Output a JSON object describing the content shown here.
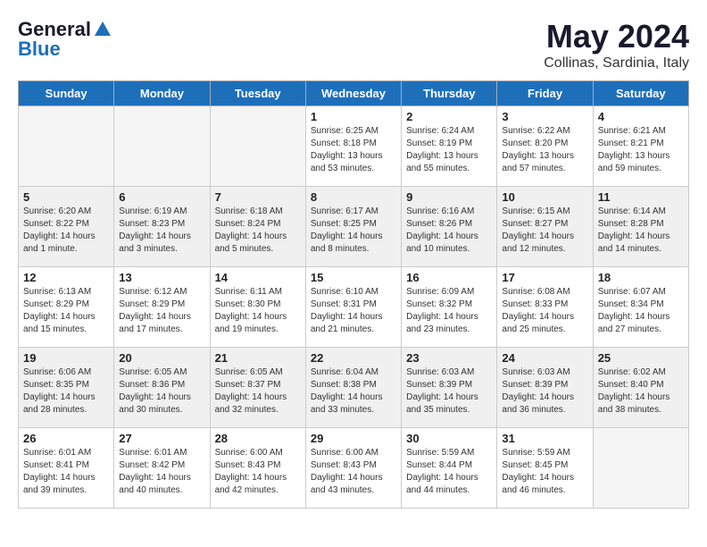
{
  "header": {
    "logo_general": "General",
    "logo_blue": "Blue",
    "month_title": "May 2024",
    "location": "Collinas, Sardinia, Italy"
  },
  "weekdays": [
    "Sunday",
    "Monday",
    "Tuesday",
    "Wednesday",
    "Thursday",
    "Friday",
    "Saturday"
  ],
  "weeks": [
    {
      "days": [
        {
          "number": null,
          "sunrise": "",
          "sunset": "",
          "daylight": ""
        },
        {
          "number": null,
          "sunrise": "",
          "sunset": "",
          "daylight": ""
        },
        {
          "number": null,
          "sunrise": "",
          "sunset": "",
          "daylight": ""
        },
        {
          "number": "1",
          "sunrise": "Sunrise: 6:25 AM",
          "sunset": "Sunset: 8:18 PM",
          "daylight": "Daylight: 13 hours and 53 minutes."
        },
        {
          "number": "2",
          "sunrise": "Sunrise: 6:24 AM",
          "sunset": "Sunset: 8:19 PM",
          "daylight": "Daylight: 13 hours and 55 minutes."
        },
        {
          "number": "3",
          "sunrise": "Sunrise: 6:22 AM",
          "sunset": "Sunset: 8:20 PM",
          "daylight": "Daylight: 13 hours and 57 minutes."
        },
        {
          "number": "4",
          "sunrise": "Sunrise: 6:21 AM",
          "sunset": "Sunset: 8:21 PM",
          "daylight": "Daylight: 13 hours and 59 minutes."
        }
      ]
    },
    {
      "days": [
        {
          "number": "5",
          "sunrise": "Sunrise: 6:20 AM",
          "sunset": "Sunset: 8:22 PM",
          "daylight": "Daylight: 14 hours and 1 minute."
        },
        {
          "number": "6",
          "sunrise": "Sunrise: 6:19 AM",
          "sunset": "Sunset: 8:23 PM",
          "daylight": "Daylight: 14 hours and 3 minutes."
        },
        {
          "number": "7",
          "sunrise": "Sunrise: 6:18 AM",
          "sunset": "Sunset: 8:24 PM",
          "daylight": "Daylight: 14 hours and 5 minutes."
        },
        {
          "number": "8",
          "sunrise": "Sunrise: 6:17 AM",
          "sunset": "Sunset: 8:25 PM",
          "daylight": "Daylight: 14 hours and 8 minutes."
        },
        {
          "number": "9",
          "sunrise": "Sunrise: 6:16 AM",
          "sunset": "Sunset: 8:26 PM",
          "daylight": "Daylight: 14 hours and 10 minutes."
        },
        {
          "number": "10",
          "sunrise": "Sunrise: 6:15 AM",
          "sunset": "Sunset: 8:27 PM",
          "daylight": "Daylight: 14 hours and 12 minutes."
        },
        {
          "number": "11",
          "sunrise": "Sunrise: 6:14 AM",
          "sunset": "Sunset: 8:28 PM",
          "daylight": "Daylight: 14 hours and 14 minutes."
        }
      ]
    },
    {
      "days": [
        {
          "number": "12",
          "sunrise": "Sunrise: 6:13 AM",
          "sunset": "Sunset: 8:29 PM",
          "daylight": "Daylight: 14 hours and 15 minutes."
        },
        {
          "number": "13",
          "sunrise": "Sunrise: 6:12 AM",
          "sunset": "Sunset: 8:29 PM",
          "daylight": "Daylight: 14 hours and 17 minutes."
        },
        {
          "number": "14",
          "sunrise": "Sunrise: 6:11 AM",
          "sunset": "Sunset: 8:30 PM",
          "daylight": "Daylight: 14 hours and 19 minutes."
        },
        {
          "number": "15",
          "sunrise": "Sunrise: 6:10 AM",
          "sunset": "Sunset: 8:31 PM",
          "daylight": "Daylight: 14 hours and 21 minutes."
        },
        {
          "number": "16",
          "sunrise": "Sunrise: 6:09 AM",
          "sunset": "Sunset: 8:32 PM",
          "daylight": "Daylight: 14 hours and 23 minutes."
        },
        {
          "number": "17",
          "sunrise": "Sunrise: 6:08 AM",
          "sunset": "Sunset: 8:33 PM",
          "daylight": "Daylight: 14 hours and 25 minutes."
        },
        {
          "number": "18",
          "sunrise": "Sunrise: 6:07 AM",
          "sunset": "Sunset: 8:34 PM",
          "daylight": "Daylight: 14 hours and 27 minutes."
        }
      ]
    },
    {
      "days": [
        {
          "number": "19",
          "sunrise": "Sunrise: 6:06 AM",
          "sunset": "Sunset: 8:35 PM",
          "daylight": "Daylight: 14 hours and 28 minutes."
        },
        {
          "number": "20",
          "sunrise": "Sunrise: 6:05 AM",
          "sunset": "Sunset: 8:36 PM",
          "daylight": "Daylight: 14 hours and 30 minutes."
        },
        {
          "number": "21",
          "sunrise": "Sunrise: 6:05 AM",
          "sunset": "Sunset: 8:37 PM",
          "daylight": "Daylight: 14 hours and 32 minutes."
        },
        {
          "number": "22",
          "sunrise": "Sunrise: 6:04 AM",
          "sunset": "Sunset: 8:38 PM",
          "daylight": "Daylight: 14 hours and 33 minutes."
        },
        {
          "number": "23",
          "sunrise": "Sunrise: 6:03 AM",
          "sunset": "Sunset: 8:39 PM",
          "daylight": "Daylight: 14 hours and 35 minutes."
        },
        {
          "number": "24",
          "sunrise": "Sunrise: 6:03 AM",
          "sunset": "Sunset: 8:39 PM",
          "daylight": "Daylight: 14 hours and 36 minutes."
        },
        {
          "number": "25",
          "sunrise": "Sunrise: 6:02 AM",
          "sunset": "Sunset: 8:40 PM",
          "daylight": "Daylight: 14 hours and 38 minutes."
        }
      ]
    },
    {
      "days": [
        {
          "number": "26",
          "sunrise": "Sunrise: 6:01 AM",
          "sunset": "Sunset: 8:41 PM",
          "daylight": "Daylight: 14 hours and 39 minutes."
        },
        {
          "number": "27",
          "sunrise": "Sunrise: 6:01 AM",
          "sunset": "Sunset: 8:42 PM",
          "daylight": "Daylight: 14 hours and 40 minutes."
        },
        {
          "number": "28",
          "sunrise": "Sunrise: 6:00 AM",
          "sunset": "Sunset: 8:43 PM",
          "daylight": "Daylight: 14 hours and 42 minutes."
        },
        {
          "number": "29",
          "sunrise": "Sunrise: 6:00 AM",
          "sunset": "Sunset: 8:43 PM",
          "daylight": "Daylight: 14 hours and 43 minutes."
        },
        {
          "number": "30",
          "sunrise": "Sunrise: 5:59 AM",
          "sunset": "Sunset: 8:44 PM",
          "daylight": "Daylight: 14 hours and 44 minutes."
        },
        {
          "number": "31",
          "sunrise": "Sunrise: 5:59 AM",
          "sunset": "Sunset: 8:45 PM",
          "daylight": "Daylight: 14 hours and 46 minutes."
        },
        {
          "number": null,
          "sunrise": "",
          "sunset": "",
          "daylight": ""
        }
      ]
    }
  ]
}
